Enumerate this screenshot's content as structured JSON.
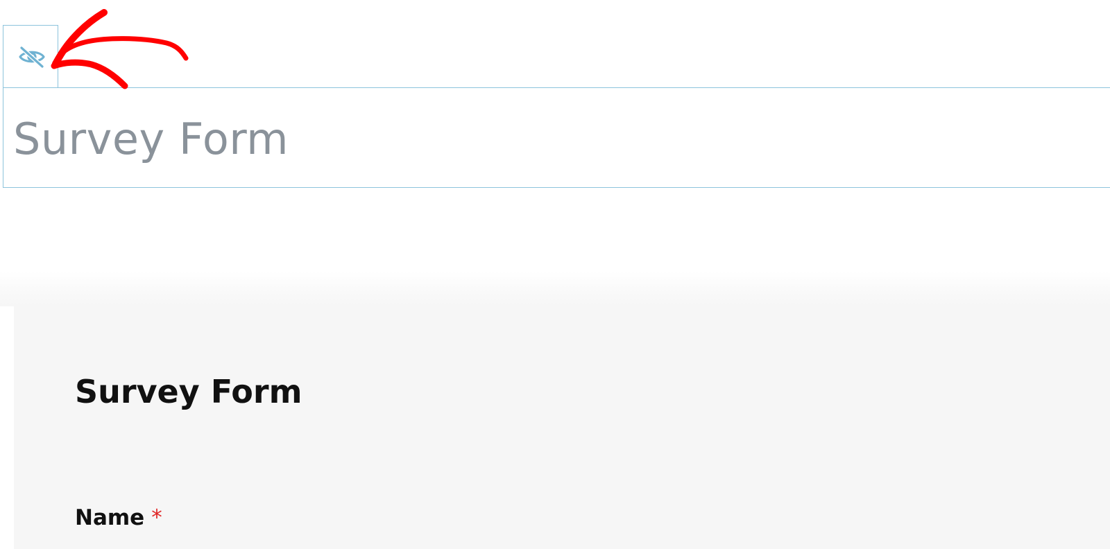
{
  "editor": {
    "toolbar": {
      "visibility_button_icon": "eye-slash-icon"
    },
    "title": "Survey Form"
  },
  "preview": {
    "heading": "Survey Form",
    "fields": [
      {
        "label": "Name",
        "required_marker": "*"
      }
    ]
  },
  "annotation": {
    "type": "arrow",
    "color": "#ff0000"
  },
  "colors": {
    "block_border": "#8cc3dc",
    "icon": "#6fb2d2",
    "title_placeholder": "#8a929a",
    "preview_background": "#f6f6f6",
    "required": "#e02727"
  }
}
